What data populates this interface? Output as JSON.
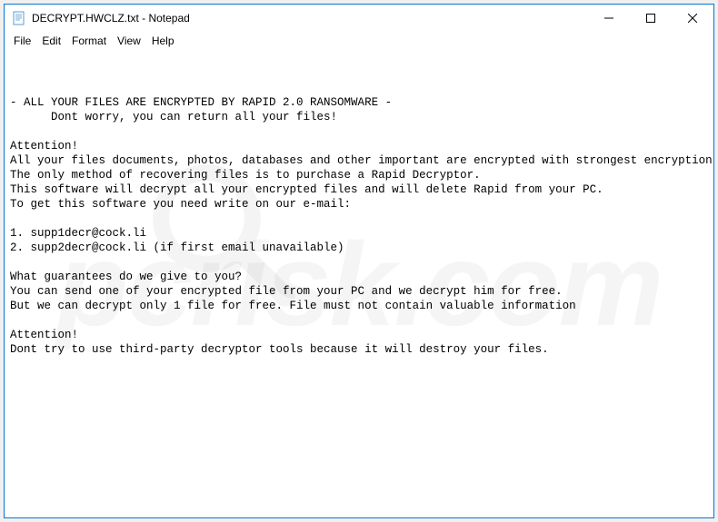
{
  "titlebar": {
    "title": "DECRYPT.HWCLZ.txt - Notepad"
  },
  "menubar": {
    "items": [
      "File",
      "Edit",
      "Format",
      "View",
      "Help"
    ]
  },
  "content": {
    "lines": [
      "- ALL YOUR FILES ARE ENCRYPTED BY RAPID 2.0 RANSOMWARE -",
      "      Dont worry, you can return all your files!",
      "",
      "Attention!",
      "All your files documents, photos, databases and other important are encrypted with strongest encryption",
      "The only method of recovering files is to purchase a Rapid Decryptor.",
      "This software will decrypt all your encrypted files and will delete Rapid from your PC.",
      "To get this software you need write on our e-mail:",
      "",
      "1. supp1decr@cock.li",
      "2. supp2decr@cock.li (if first email unavailable)",
      "",
      "What guarantees do we give to you?",
      "You can send one of your encrypted file from your PC and we decrypt him for free.",
      "But we can decrypt only 1 file for free. File must not contain valuable information",
      "",
      "Attention!",
      "Dont try to use third-party decryptor tools because it will destroy your files."
    ]
  },
  "watermark": {
    "text": "pcrisk.com"
  }
}
